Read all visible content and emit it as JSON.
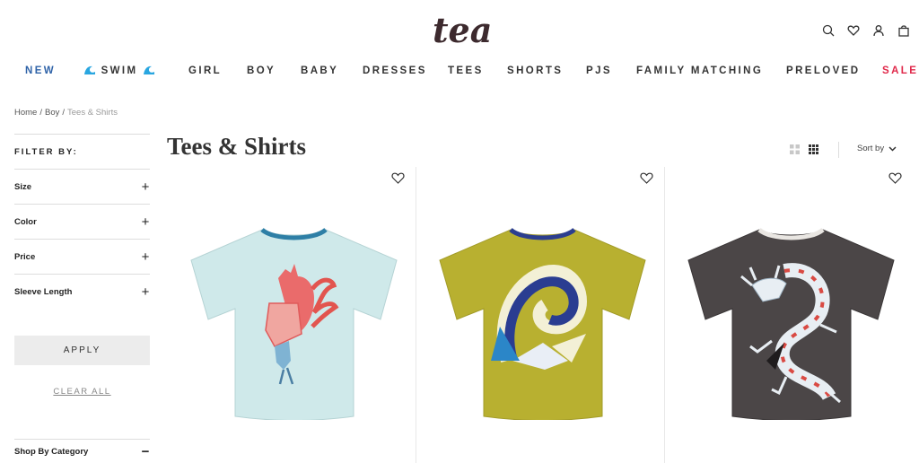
{
  "brand": {
    "logo_text": "tea"
  },
  "header": {
    "icons": [
      "search-icon",
      "heart-icon",
      "account-icon",
      "bag-icon"
    ]
  },
  "nav": {
    "items": [
      {
        "label": "NEW"
      },
      {
        "label": "SWIM"
      },
      {
        "label": "GIRL"
      },
      {
        "label": "BOY"
      },
      {
        "label": "BABY"
      },
      {
        "label": "DRESSES"
      },
      {
        "label": "TEES"
      },
      {
        "label": "SHORTS"
      },
      {
        "label": "PJS"
      },
      {
        "label": "FAMILY MATCHING"
      },
      {
        "label": "PRELOVED"
      },
      {
        "label": "SALE"
      }
    ],
    "colors": {
      "new": "#2f63a8",
      "sale": "#e0284a",
      "wave": "#29a6e0"
    }
  },
  "breadcrumb": {
    "items": [
      "Home",
      "Boy",
      "Tees & Shirts"
    ],
    "separator": "/"
  },
  "filters": {
    "title": "FILTER BY:",
    "facets": [
      {
        "label": "Size",
        "toggle": "+"
      },
      {
        "label": "Color",
        "toggle": "+"
      },
      {
        "label": "Price",
        "toggle": "+"
      },
      {
        "label": "Sleeve Length",
        "toggle": "+"
      }
    ],
    "apply_label": "APPLY",
    "clear_label": "CLEAR ALL",
    "shop_by_category": {
      "label": "Shop By Category",
      "toggle": "−"
    }
  },
  "page": {
    "title": "Tees & Shirts"
  },
  "toolbar": {
    "sort_label": "Sort by",
    "view_icons": [
      "grid-large-icon",
      "grid-small-icon"
    ]
  },
  "products": [
    {
      "image": "rooster-tee",
      "shirt_color": "#cfe9ea"
    },
    {
      "image": "wave-tee",
      "shirt_color": "#b8b030"
    },
    {
      "image": "dragon-tee",
      "shirt_color": "#4b4647"
    }
  ]
}
